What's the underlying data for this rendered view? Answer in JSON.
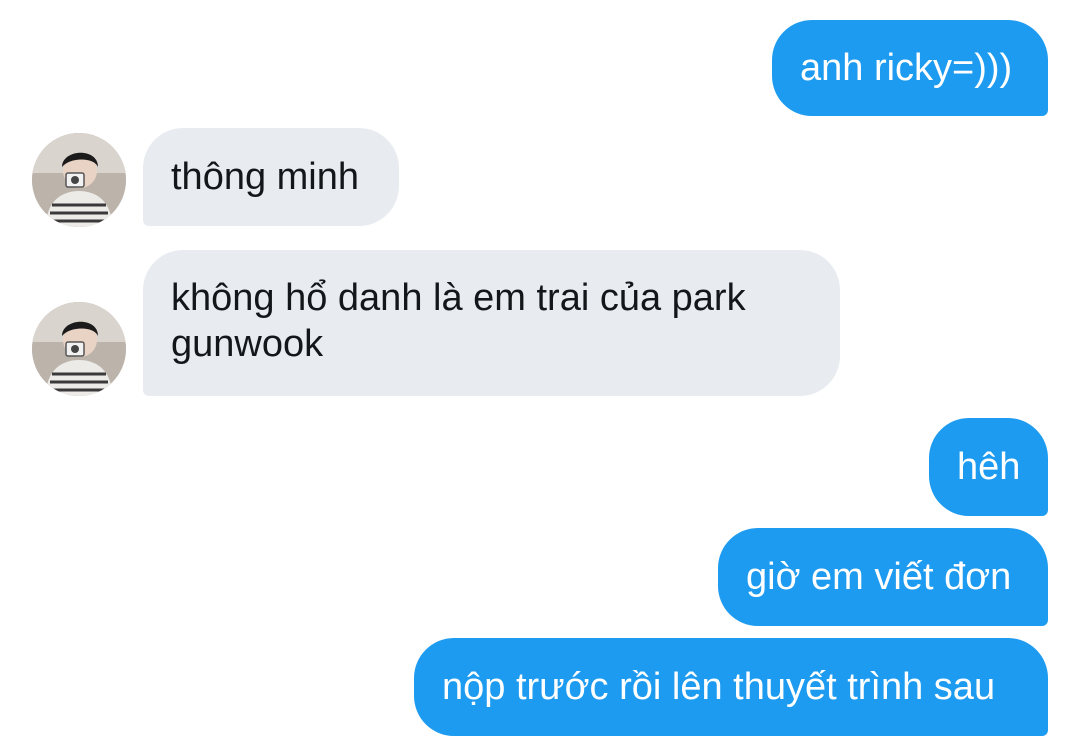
{
  "conversation": {
    "messages": [
      {
        "sender": "me",
        "text": "anh ricky=)))"
      },
      {
        "sender": "other",
        "text": "thông minh"
      },
      {
        "sender": "other",
        "text": "không hổ danh là em trai của park gunwook"
      },
      {
        "sender": "me",
        "text": "hêh"
      },
      {
        "sender": "me",
        "text": "giờ em viết đơn"
      },
      {
        "sender": "me",
        "text": "nộp trước rồi lên thuyết trình sau"
      }
    ]
  },
  "colors": {
    "outgoing_bubble": "#1d9bf0",
    "incoming_bubble": "#e8ecf1",
    "background": "#ffffff"
  }
}
